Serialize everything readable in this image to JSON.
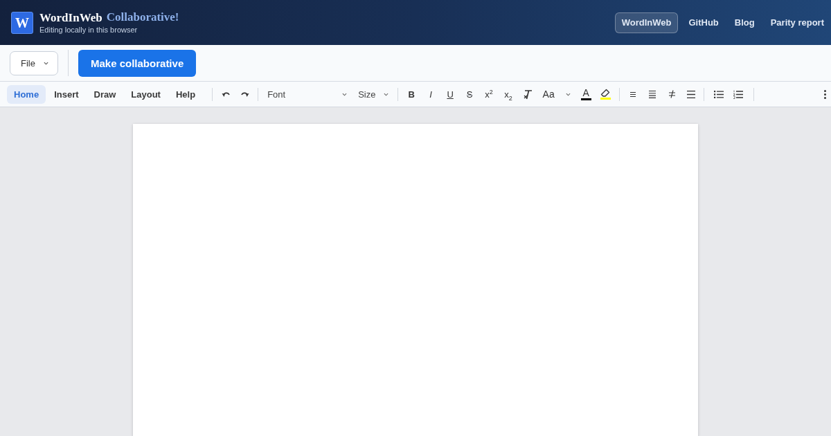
{
  "header": {
    "logo_letter": "W",
    "brand": "WordInWeb",
    "edition": "Collaborative!",
    "subtitle": "Editing locally in this browser",
    "nav": [
      {
        "label": "WordInWeb",
        "selected": true
      },
      {
        "label": "GitHub",
        "selected": false
      },
      {
        "label": "Blog",
        "selected": false
      },
      {
        "label": "Parity report",
        "selected": false
      }
    ]
  },
  "action_bar": {
    "file_menu": {
      "label": "File"
    },
    "primary_button": {
      "label": "Make collaborative"
    }
  },
  "ribbon": {
    "tabs": [
      {
        "label": "Home",
        "selected": true
      },
      {
        "label": "Insert",
        "selected": false
      },
      {
        "label": "Draw",
        "selected": false
      },
      {
        "label": "Layout",
        "selected": false
      },
      {
        "label": "Help",
        "selected": false
      }
    ],
    "font_select": {
      "label": "Font"
    },
    "size_select": {
      "label": "Size"
    },
    "format_buttons": [
      {
        "kind": "bold",
        "label": "B"
      },
      {
        "kind": "italic",
        "label": "I"
      },
      {
        "kind": "underline",
        "label": "U"
      },
      {
        "kind": "strike",
        "label": "S"
      },
      {
        "kind": "superscript",
        "label": "x$^{2}$"
      },
      {
        "kind": "subscript",
        "label": "x$_{2}$"
      }
    ],
    "case_button": {
      "label": "Aa"
    },
    "font_color": {
      "label": "A",
      "color": "#000000"
    },
    "highlight": {
      "color": "#ffff00"
    }
  }
}
